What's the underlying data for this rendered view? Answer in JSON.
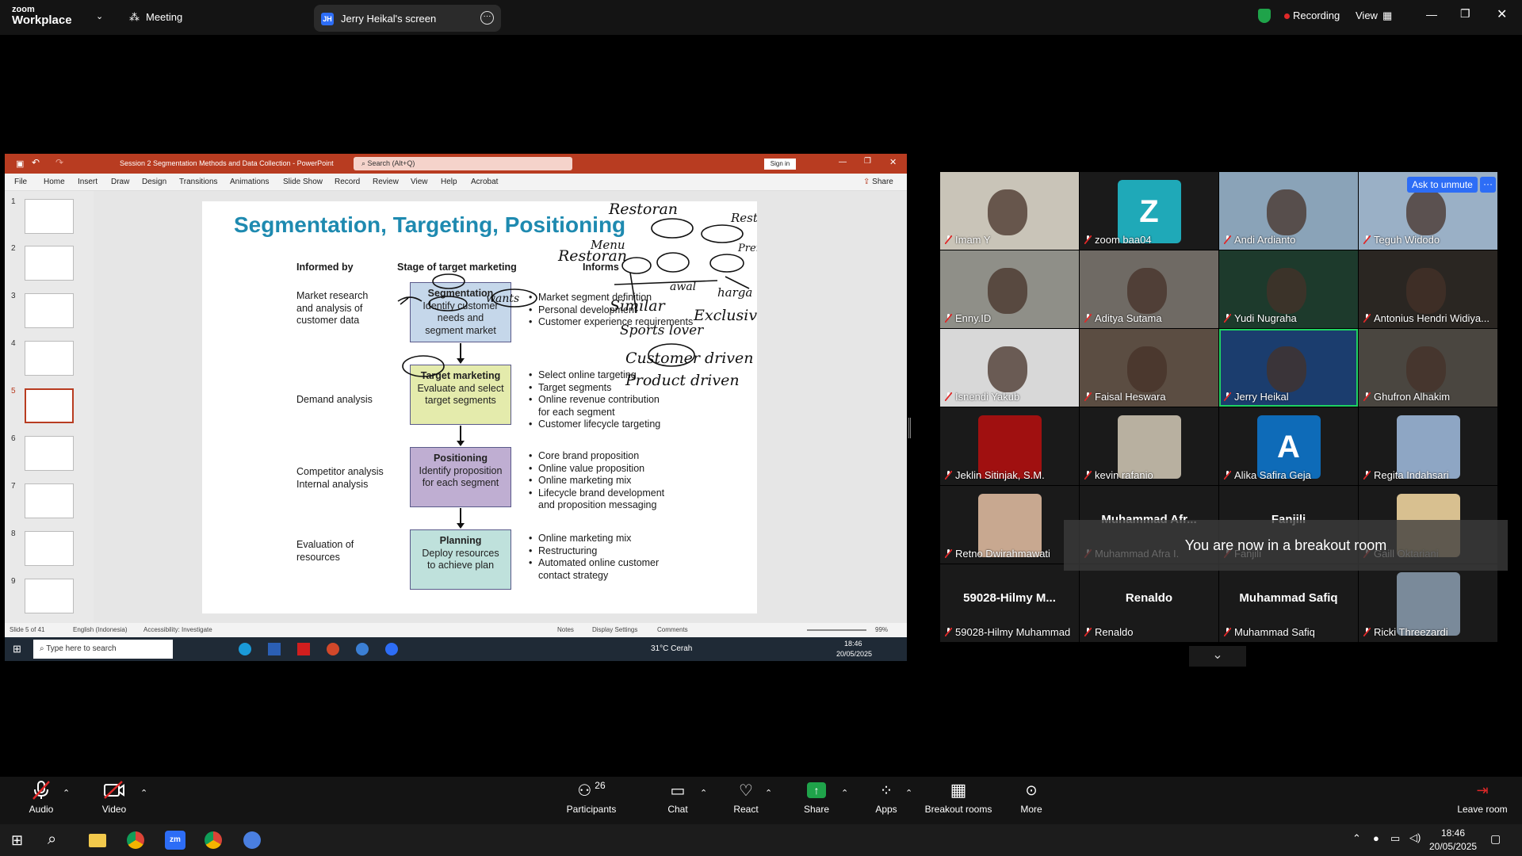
{
  "zoom": {
    "brand_top": "zoom",
    "brand_bottom": "Workplace",
    "meeting_label": "Meeting",
    "share_initials": "JH",
    "share_title": "Jerry Heikal's screen",
    "recording_label": "Recording",
    "view_label": "View"
  },
  "ppt": {
    "title": "Session 2 Segmentation Methods and Data Collection  -  PowerPoint",
    "search_placeholder": "Search (Alt+Q)",
    "sign_in": "Sign in",
    "share": "Share",
    "tabs": [
      "File",
      "Home",
      "Insert",
      "Draw",
      "Design",
      "Transitions",
      "Animations",
      "Slide Show",
      "Record",
      "Review",
      "View",
      "Help",
      "Acrobat"
    ],
    "thumb_numbers": [
      "1",
      "2",
      "3",
      "4",
      "5",
      "6",
      "7",
      "8",
      "9"
    ],
    "status": {
      "slide": "Slide 5 of 41",
      "language": "English (Indonesia)",
      "accessibility": "Accessibility: Investigate",
      "notes": "Notes",
      "display": "Display Settings",
      "comments": "Comments",
      "zoom": "99%"
    }
  },
  "slide": {
    "title": "Segmentation, Targeting, Positioning",
    "col_informed": "Informed by",
    "col_stage": "Stage of target marketing",
    "col_informs": "Informs",
    "rows": [
      {
        "informed": "Market research\nand analysis of\ncustomer data",
        "stage_title": "Segmentation",
        "stage_body": "Identify customer\nneeds and\nsegment market",
        "informs": [
          "Market segment definition",
          "Personal development",
          "Customer experience requirements"
        ]
      },
      {
        "informed": "Demand analysis",
        "stage_title": "Target marketing",
        "stage_body": "Evaluate and select\ntarget segments",
        "informs": [
          "Select online targeting",
          "Target segments",
          "Online revenue contribution\nfor each segment",
          "Customer lifecycle targeting"
        ]
      },
      {
        "informed": "Competitor analysis\nInternal analysis",
        "stage_title": "Positioning",
        "stage_body": "Identify proposition\nfor each segment",
        "informs": [
          "Core brand proposition",
          "Online value proposition",
          "Online marketing mix",
          "Lifecycle brand development\nand proposition messaging"
        ]
      },
      {
        "informed": "Evaluation of\nresources",
        "stage_title": "Planning",
        "stage_body": "Deploy resources\nto achieve plan",
        "informs": [
          "Online marketing mix",
          "Restructuring",
          "Automated online customer\ncontact strategy"
        ]
      }
    ],
    "handwriting": [
      "Restoran",
      "Restoran",
      "Menu",
      "Resto",
      "Premium",
      "Sports lover",
      "Similar",
      "Exclusive",
      "Customer driven",
      "Product driven",
      "wants",
      "harga",
      "awal"
    ]
  },
  "inner_taskbar": {
    "search_placeholder": "Type here to search",
    "weather": "31°C  Cerah",
    "time": "18:46",
    "date": "20/05/2025"
  },
  "gallery": {
    "ask_unmute": "Ask to unmute",
    "participants": [
      {
        "name": "Imam Y",
        "type": "video",
        "color": "#c9c4b8"
      },
      {
        "name": "zoom baa04",
        "type": "avatar",
        "letter": "Z",
        "color": "#1fa9b8"
      },
      {
        "name": "Andi Ardianto",
        "type": "video",
        "color": "#8aa3b8"
      },
      {
        "name": "Teguh Widodo",
        "type": "video",
        "color": "#9ab0c6"
      },
      {
        "name": "Enny.ID",
        "type": "video",
        "color": "#8f8f88"
      },
      {
        "name": "Aditya Sutama",
        "type": "video",
        "color": "#6f6a64"
      },
      {
        "name": "Yudi Nugraha",
        "type": "video",
        "color": "#1d3a2c"
      },
      {
        "name": "Antonius Hendri Widiya...",
        "type": "video",
        "color": "#2a2622"
      },
      {
        "name": "Isnendi Yakub",
        "type": "video",
        "color": "#d8d8d8"
      },
      {
        "name": "Faisal Heswara",
        "type": "video",
        "color": "#5b4d42"
      },
      {
        "name": "Jerry Heikal",
        "type": "video",
        "color": "#1b3d6e"
      },
      {
        "name": "Ghufron Alhakim",
        "type": "video",
        "color": "#4a4640"
      },
      {
        "name": "Jeklin Sitinjak, S.M.",
        "type": "avatar-img",
        "color": "#a01010"
      },
      {
        "name": "kevin rafanio",
        "type": "avatar-img",
        "color": "#b8b0a0"
      },
      {
        "name": "Alika Safira Geja",
        "type": "avatar",
        "letter": "A",
        "color": "#0e6bb8"
      },
      {
        "name": "Regita Indahsari",
        "type": "avatar-img",
        "color": "#8ea6c4"
      },
      {
        "name": "Retno Dwirahmawati",
        "type": "avatar-img",
        "color": "#c8a890"
      },
      {
        "name": "Muhammad Afra I.",
        "type": "name",
        "big": "Muhammad Afr..."
      },
      {
        "name": "Fanjili",
        "type": "name",
        "big": "Fanjili"
      },
      {
        "name": "Gaill Oktariani",
        "type": "avatar-img",
        "color": "#d8c090"
      },
      {
        "name": "59028-Hilmy Muhammad",
        "type": "name",
        "big": "59028-Hilmy M..."
      },
      {
        "name": "Renaldo",
        "type": "name",
        "big": "Renaldo"
      },
      {
        "name": "Muhammad Safiq",
        "type": "name",
        "big": "Muhammad Safiq"
      },
      {
        "name": "Ricki Threezardi",
        "type": "avatar-img",
        "color": "#7a8a9a"
      }
    ],
    "toast": "You are now in a breakout room"
  },
  "toolbar": {
    "audio": "Audio",
    "video": "Video",
    "participants": "Participants",
    "participants_count": "26",
    "chat": "Chat",
    "react": "React",
    "share": "Share",
    "apps": "Apps",
    "breakout": "Breakout rooms",
    "more": "More",
    "leave": "Leave room"
  },
  "win_taskbar": {
    "time": "18:46",
    "date": "20/05/2025"
  },
  "colors": {
    "ppt_red": "#b83c21",
    "zoom_green": "#1fa34a",
    "seg_blue": "#c5d7ea",
    "target_yellow": "#e4ebac",
    "pos_purple": "#bfaed2",
    "plan_teal": "#bfe1dc",
    "title_blue": "#1e8ab0"
  }
}
